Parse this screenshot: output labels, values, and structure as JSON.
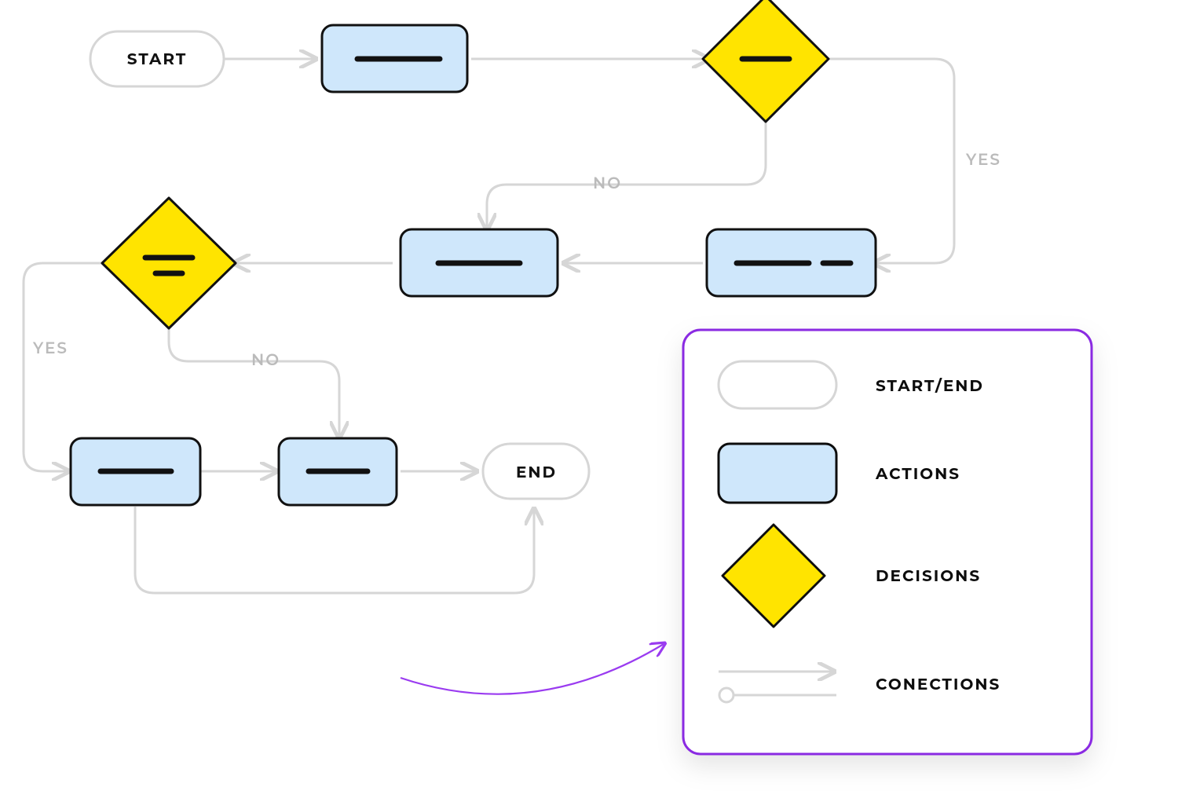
{
  "nodes": {
    "start": {
      "label": "START"
    },
    "end": {
      "label": "END"
    }
  },
  "edges": {
    "d1_yes": {
      "label": "YES"
    },
    "d1_no": {
      "label": "NO"
    },
    "d2_yes": {
      "label": "YES"
    },
    "d2_no": {
      "label": "NO"
    }
  },
  "legend": {
    "start_end": "START/END",
    "actions": "ACTIONS",
    "decisions": "DECISIONS",
    "connections": "CONECTIONS"
  },
  "colors": {
    "action_fill": "#cfe7fb",
    "decision_fill": "#ffe400",
    "node_stroke": "#111111",
    "edge_stroke": "#d6d6d6",
    "edge_text": "#bbbbbb",
    "legend_stroke": "#8a2be2",
    "pointer_stroke": "#9a3bf0"
  }
}
